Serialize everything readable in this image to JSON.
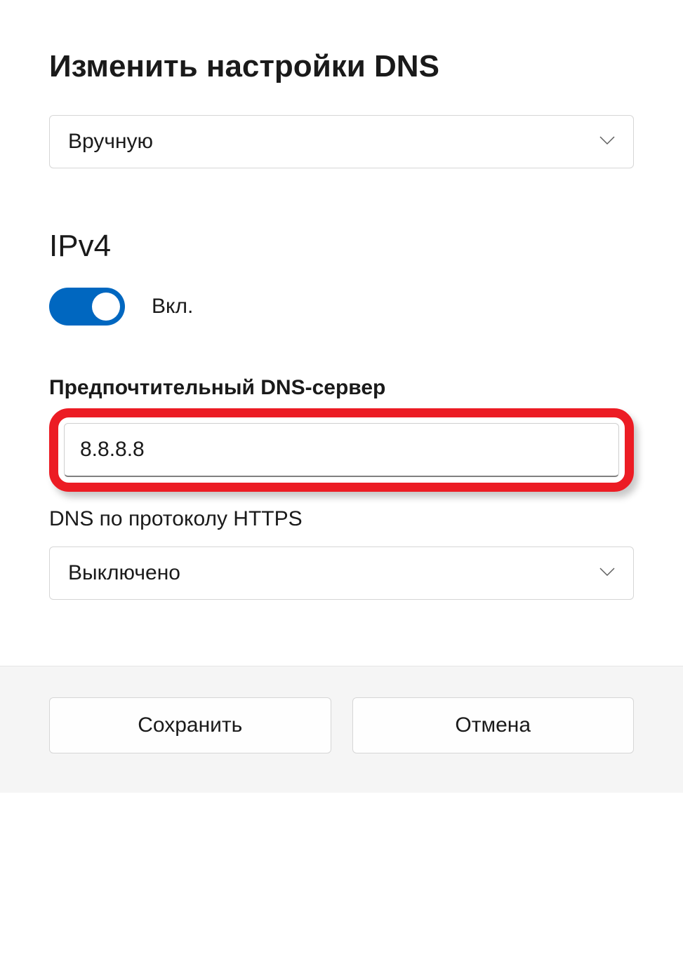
{
  "title": "Изменить настройки DNS",
  "mode_dropdown": {
    "selected": "Вручную"
  },
  "ipv4": {
    "heading": "IPv4",
    "toggle_label": "Вкл.",
    "preferred_dns_label": "Предпочтительный DNS-сервер",
    "preferred_dns_value": "8.8.8.8",
    "doh_label": "DNS по протоколу HTTPS",
    "doh_selected": "Выключено"
  },
  "footer": {
    "save": "Сохранить",
    "cancel": "Отмена"
  }
}
